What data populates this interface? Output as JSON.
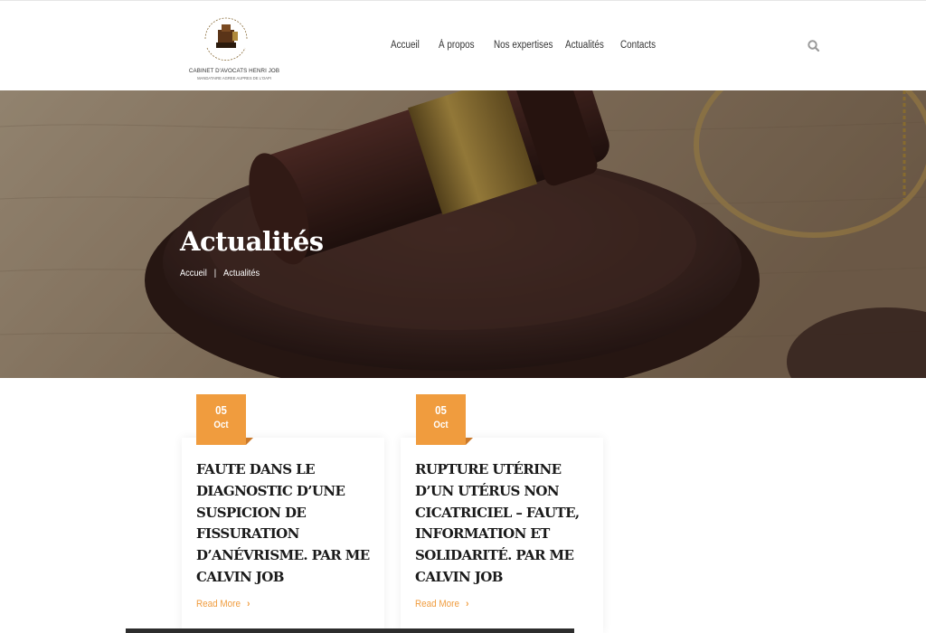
{
  "header": {
    "logo": {
      "name": "CABINET D'AVOCATS HENRI JOB",
      "subtitle": "MANDATAIRE AGREE AUPRES DE L'OAPI"
    },
    "nav": [
      "Accueil",
      "À propos",
      "Nos expertises",
      "Actualités",
      "Contacts"
    ],
    "search_icon": "search-icon"
  },
  "hero": {
    "title": "Actualités",
    "breadcrumb": {
      "home": "Accueil",
      "separator": "|",
      "current": "Actualités"
    }
  },
  "posts": [
    {
      "day": "05",
      "month": "Oct",
      "title": "FAUTE DANS LE DIAGNOSTIC D’UNE SUSPICION DE FISSURATION D’ANÉVRISME. PAR ME CALVIN JOB",
      "read_more": "Read More"
    },
    {
      "day": "05",
      "month": "Oct",
      "title": "RUPTURE UTÉRINE D’UN UTÉRUS NON CICATRICIEL – FAUTE, INFORMATION ET SOLIDARITÉ. PAR ME CALVIN JOB",
      "read_more": "Read More"
    }
  ],
  "colors": {
    "accent": "#f09c3e",
    "accent_dark": "#c9782a",
    "hero_overlay": "#3a2a22",
    "text": "#1a1a1a"
  }
}
